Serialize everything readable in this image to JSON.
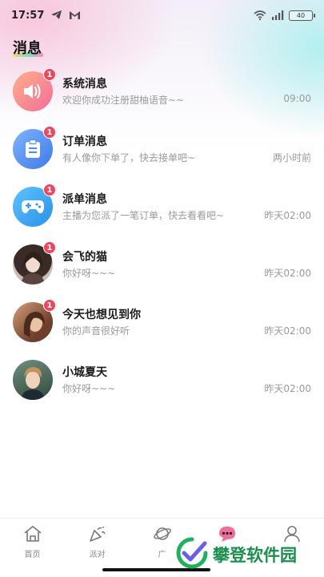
{
  "status_bar": {
    "time": "17:57",
    "left_icons": [
      "telegram-icon",
      "gmail-icon"
    ],
    "right_icons": [
      "wifi-icon",
      "signal-icon"
    ],
    "battery": "40"
  },
  "header": {
    "title": "消息"
  },
  "messages": [
    {
      "name": "系统消息",
      "preview": "欢迎你成功注册甜柚语音~~",
      "time": "09:00",
      "badge": "1",
      "avatar": "speaker-icon"
    },
    {
      "name": "订单消息",
      "preview": "有人像你下单了，快去接单吧~",
      "time": "两小时前",
      "badge": "1",
      "avatar": "clipboard-icon"
    },
    {
      "name": "派单消息",
      "preview": "主播为您派了一笔订单，快去看看吧~",
      "time": "昨天02:00",
      "badge": "1",
      "avatar": "gamepad-icon"
    },
    {
      "name": "会飞的猫",
      "preview": "你好呀~~~",
      "time": "昨天02:00",
      "badge": "1",
      "avatar": "user-photo"
    },
    {
      "name": "今天也想见到你",
      "preview": "你的声音很好听",
      "time": "昨天02:00",
      "badge": "1",
      "avatar": "user-photo"
    },
    {
      "name": "小城夏天",
      "preview": "你好呀~~~",
      "time": "昨天02:00",
      "badge": "",
      "avatar": "user-photo"
    }
  ],
  "bottom_nav": [
    {
      "label": "首页",
      "icon": "home-icon"
    },
    {
      "label": "派对",
      "icon": "party-icon"
    },
    {
      "label": "广",
      "icon": "planet-icon"
    },
    {
      "label": "",
      "icon": "message-icon",
      "active": true
    },
    {
      "label": "",
      "icon": "profile-icon"
    }
  ],
  "watermark": {
    "text": "攀登软件园"
  },
  "colors": {
    "badge": "#f0455e",
    "system_avatar": "#f7899f",
    "order_avatar": "#4b8ff1",
    "dispatch_avatar": "#3aa8f2",
    "watermark": "#1b8f4d"
  }
}
